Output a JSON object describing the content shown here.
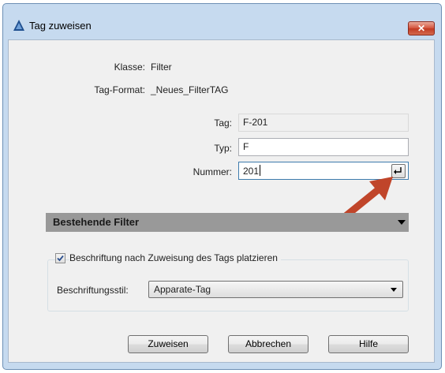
{
  "window": {
    "title": "Tag zuweisen",
    "close_label": "✕"
  },
  "info": {
    "klasse_label": "Klasse:",
    "klasse_value": "Filter",
    "tagformat_label": "Tag-Format:",
    "tagformat_value": "_Neues_FilterTAG"
  },
  "fields": {
    "tag_label": "Tag:",
    "tag_value": "F-201",
    "typ_label": "Typ:",
    "typ_value": "F",
    "nummer_label": "Nummer:",
    "nummer_value": "201"
  },
  "section": {
    "title": "Bestehende Filter"
  },
  "annotation": {
    "checkbox_checked": true,
    "checkbox_label": "Beschriftung nach Zuweisung des Tags platzieren",
    "style_label": "Beschriftungsstil:",
    "style_value": "Apparate-Tag"
  },
  "buttons": {
    "assign": "Zuweisen",
    "cancel": "Abbrechen",
    "help": "Hilfe"
  },
  "colors": {
    "arrow": "#c0452a",
    "frame": "#c6daef",
    "section_bar": "#999999"
  },
  "icons": {
    "app": "autocad-a-icon",
    "close": "close-icon",
    "pick": "return-arrow-icon",
    "dropdown": "chevron-down-icon",
    "checkbox": "checkmark-icon"
  }
}
